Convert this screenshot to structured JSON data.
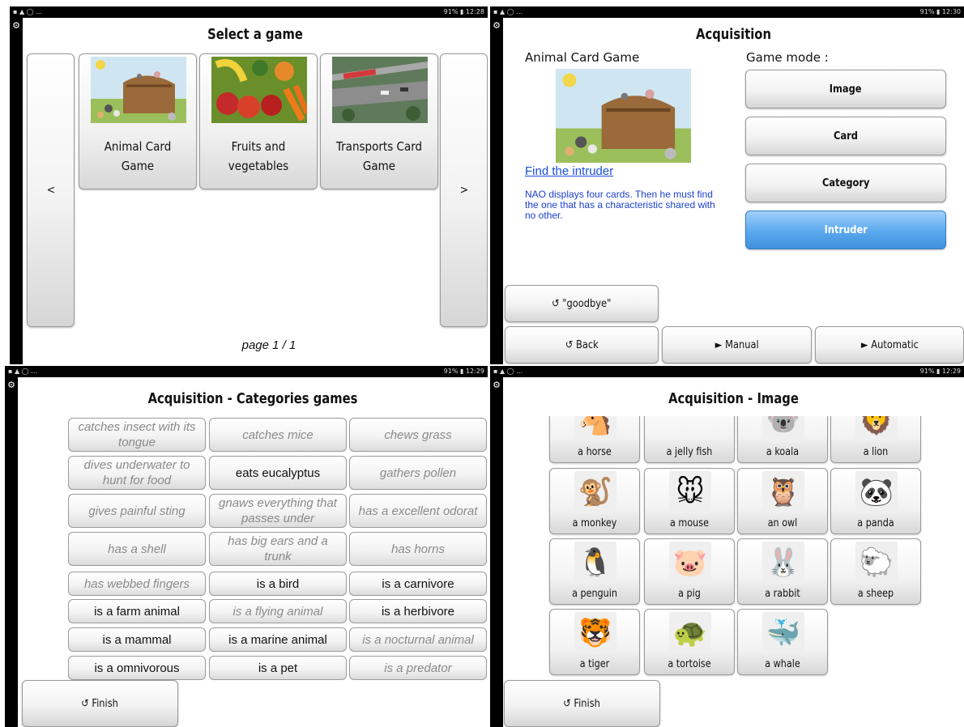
{
  "screens": {
    "select_game": {
      "status_time": "91% ▮ 12:28",
      "title": "Select a game",
      "prev_label": "<",
      "next_label": ">",
      "games": [
        {
          "name_line1": "Animal Card",
          "name_line2": "Game"
        },
        {
          "name_line1": "Fruits and",
          "name_line2": "vegetables"
        },
        {
          "name_line1": "Transports Card",
          "name_line2": "Game"
        }
      ],
      "pager": "page 1 / 1"
    },
    "acquisition": {
      "status_time": "91% ▮ 12:30",
      "title": "Acquisition",
      "game_name": "Animal Card Game",
      "mode_label": "Game mode :",
      "modes": [
        "Image",
        "Card",
        "Category",
        "Intruder"
      ],
      "link": "Find the intruder",
      "description": "NAO displays four cards. Then he must find the one that has a characteristic shared with no other.",
      "goodbye": "↺ \"goodbye\"",
      "back": "↺ Back",
      "manual": "► Manual",
      "automatic": "► Automatic"
    },
    "categories": {
      "status_time": "91% ▮ 12:29",
      "title": "Acquisition - Categories games",
      "items": [
        "catches insect with its tongue",
        "catches mice",
        "chews grass",
        "dives underwater to hunt for food",
        "eats eucalyptus",
        "gathers pollen",
        "gives painful sting",
        "gnaws everything that passes under",
        "has a excellent odorat",
        "has a shell",
        "has big ears and a trunk",
        "has horns",
        "has webbed fingers",
        "is a bird",
        "is a carnivore",
        "is a farm animal",
        "is a flying animal",
        "is a herbivore",
        "is a mammal",
        "is a marine animal",
        "is a nocturnal animal",
        "is a omnivorous",
        "is a pet",
        "is a predator"
      ],
      "finish": "↺ Finish"
    },
    "image": {
      "status_time": "91% ▮ 12:29",
      "title": "Acquisition - Image",
      "animals": [
        {
          "name": "a horse",
          "icon": "horse-icon",
          "glyph": "🐴"
        },
        {
          "name": "a jelly fish",
          "icon": "jellyfish-icon",
          "glyph": ""
        },
        {
          "name": "a koala",
          "icon": "koala-icon",
          "glyph": "🐨"
        },
        {
          "name": "a lion",
          "icon": "lion-icon",
          "glyph": "🦁"
        },
        {
          "name": "a monkey",
          "icon": "monkey-icon",
          "glyph": "🐒"
        },
        {
          "name": "a mouse",
          "icon": "mouse-icon",
          "glyph": "🐭"
        },
        {
          "name": "an owl",
          "icon": "owl-icon",
          "glyph": "🦉"
        },
        {
          "name": "a panda",
          "icon": "panda-icon",
          "glyph": "🐼"
        },
        {
          "name": "a penguin",
          "icon": "penguin-icon",
          "glyph": "🐧"
        },
        {
          "name": "a pig",
          "icon": "pig-icon",
          "glyph": "🐷"
        },
        {
          "name": "a rabbit",
          "icon": "rabbit-icon",
          "glyph": "🐰"
        },
        {
          "name": "a sheep",
          "icon": "sheep-icon",
          "glyph": "🐑"
        },
        {
          "name": "a tiger",
          "icon": "tiger-icon",
          "glyph": "🐯"
        },
        {
          "name": "a tortoise",
          "icon": "tortoise-icon",
          "glyph": "🐢"
        },
        {
          "name": "a whale",
          "icon": "whale-icon",
          "glyph": "🐳"
        }
      ],
      "finish": "↺ Finish"
    }
  },
  "colors": {
    "link": "#1a4fd8",
    "selected_mode": "#5aa8ee",
    "disabled_text": "#8a8a8a"
  }
}
